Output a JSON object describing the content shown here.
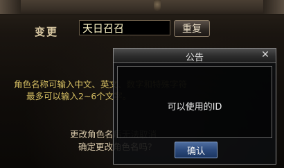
{
  "change_row": {
    "label": "变更",
    "name_value": "天日召召",
    "reset_label": "重复"
  },
  "info": {
    "line1": "角色名称可输入中文、英文、数字和特殊字符",
    "line2": "最多可以输入2~6个文字。",
    "line3": "更改角色名后无法取消",
    "line4": "确定更改角色名吗？"
  },
  "dialog": {
    "title": "公告",
    "close_glyph": "✕",
    "message": "可以使用的ID",
    "confirm_label": "确认"
  },
  "colors": {
    "info_text": "#d6bf63",
    "confirm_button": "#2c4a7c"
  }
}
